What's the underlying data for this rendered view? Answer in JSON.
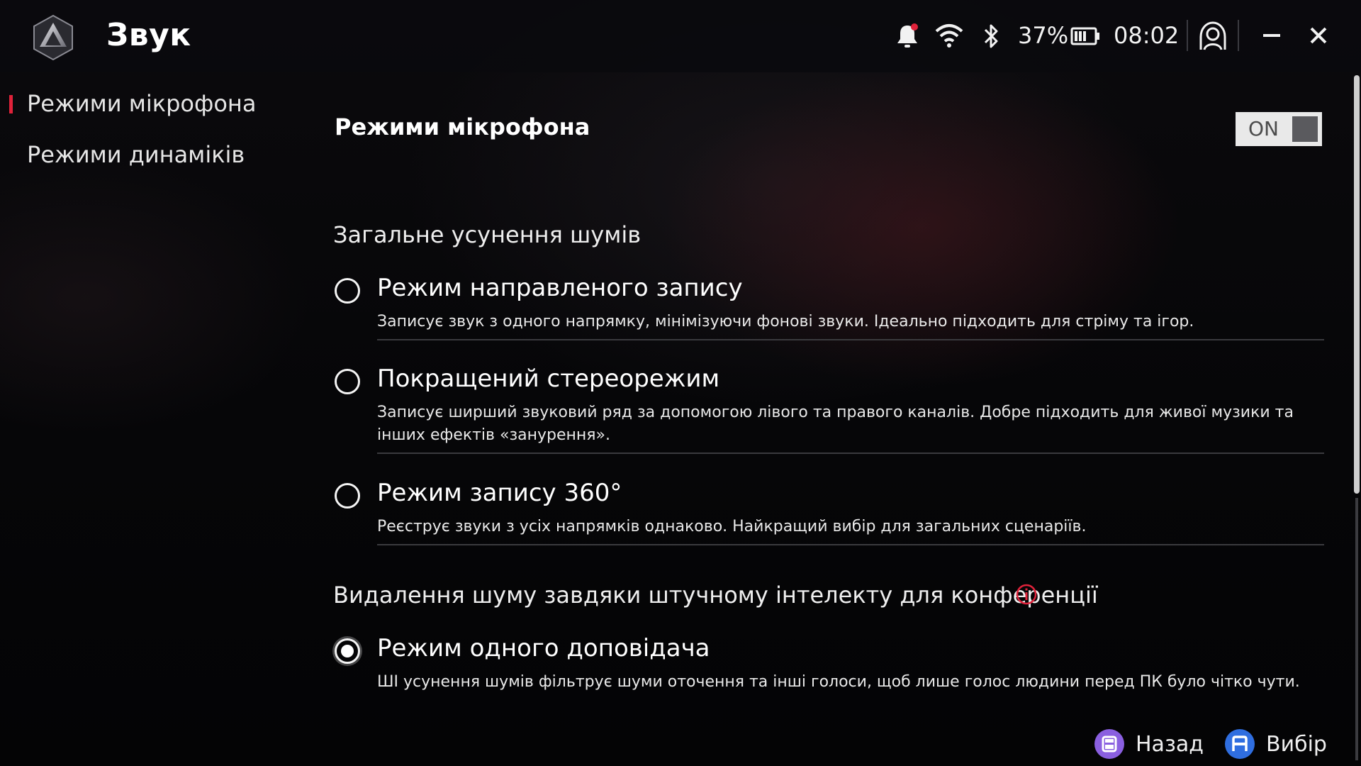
{
  "header": {
    "title": "Звук",
    "battery_percent": "37%",
    "time": "08:02"
  },
  "sidebar": {
    "items": [
      {
        "label": "Режими мікрофона",
        "active": true
      },
      {
        "label": "Режими динаміків",
        "active": false
      }
    ]
  },
  "main": {
    "section_title": "Режими мікрофона",
    "toggle_label": "ON",
    "groups": [
      {
        "title": "Загальне усунення шумів",
        "options": [
          {
            "title": "Режим направленого запису",
            "description": "Записує звук з одного напрямку, мінімізуючи фонові звуки. Ідеально підходить для стріму та ігор.",
            "selected": false
          },
          {
            "title": "Покращений стереорежим",
            "description": "Записує ширший звуковий ряд за допомогою лівого та правого каналів. Добре підходить для живої музики та інших ефектів «занурення».",
            "selected": false
          },
          {
            "title": "Режим запису 360°",
            "description": "Реєструє звуки з усіх напрямків однаково. Найкращий вибір для загальних сценаріїв.",
            "selected": false
          }
        ]
      },
      {
        "title": "Видалення шуму завдяки штучному інтелекту для конференції",
        "options": [
          {
            "title": "Режим одного доповідача",
            "description": "ШІ усунення шумів фільтрує шуми оточення та інші голоси, щоб лише голос людини перед ПК було чітко чути.",
            "selected": true
          }
        ]
      }
    ]
  },
  "footer": {
    "back_label": "Назад",
    "select_label": "Вибір"
  },
  "colors": {
    "accent_red": "#e0223a",
    "back_badge": "#8a5fe0",
    "select_badge": "#2f6ee0"
  },
  "icons": {
    "logo": "armoury-crate-logo-icon",
    "notification": "bell-icon",
    "wifi": "wifi-icon",
    "bluetooth": "bluetooth-icon",
    "battery": "battery-icon",
    "profile": "user-support-icon",
    "minimize": "minimize-icon",
    "close": "close-icon",
    "info": "info-icon",
    "back_badge": "button-b-icon",
    "select_badge": "button-a-icon"
  }
}
